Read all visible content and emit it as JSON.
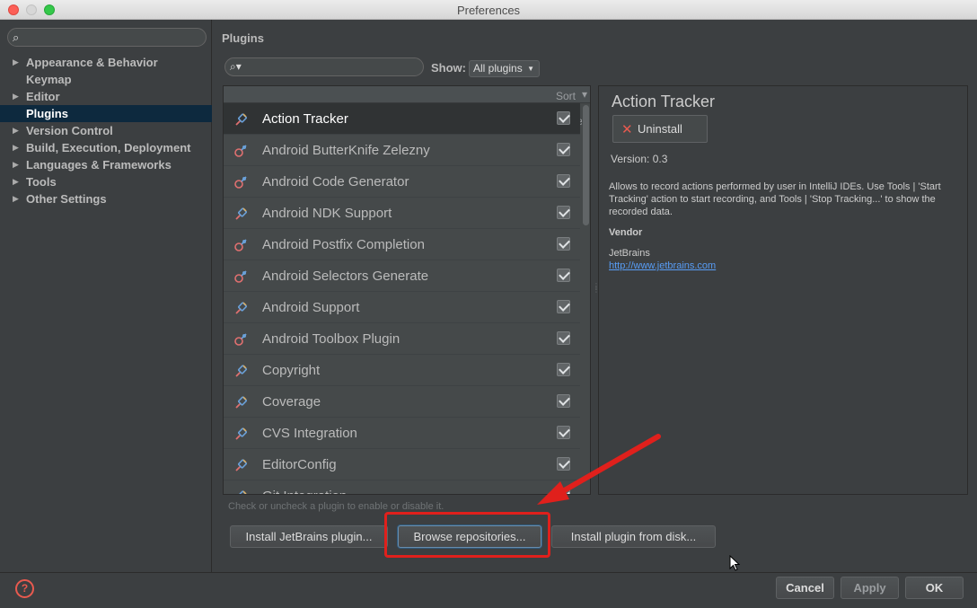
{
  "window": {
    "title": "Preferences"
  },
  "sidebar": {
    "items": [
      {
        "label": "Appearance & Behavior",
        "expandable": true
      },
      {
        "label": "Keymap",
        "expandable": false
      },
      {
        "label": "Editor",
        "expandable": true
      },
      {
        "label": "Plugins",
        "expandable": false,
        "selected": true
      },
      {
        "label": "Version Control",
        "expandable": true
      },
      {
        "label": "Build, Execution, Deployment",
        "expandable": true
      },
      {
        "label": "Languages & Frameworks",
        "expandable": true
      },
      {
        "label": "Tools",
        "expandable": true
      },
      {
        "label": "Other Settings",
        "expandable": true
      }
    ]
  },
  "plugins": {
    "title": "Plugins",
    "show_label": "Show:",
    "show_value": "All plugins",
    "sort_label": "Sort by: name",
    "list": [
      {
        "name": "Action Tracker",
        "checked": true,
        "selected": true
      },
      {
        "name": "Android ButterKnife Zelezny",
        "checked": true
      },
      {
        "name": "Android Code Generator",
        "checked": true
      },
      {
        "name": "Android NDK Support",
        "checked": true
      },
      {
        "name": "Android Postfix Completion",
        "checked": true
      },
      {
        "name": "Android Selectors Generate",
        "checked": true
      },
      {
        "name": "Android Support",
        "checked": true
      },
      {
        "name": "Android Toolbox Plugin",
        "checked": true
      },
      {
        "name": "Copyright",
        "checked": true
      },
      {
        "name": "Coverage",
        "checked": true
      },
      {
        "name": "CVS Integration",
        "checked": true
      },
      {
        "name": "EditorConfig",
        "checked": true
      },
      {
        "name": "Git Integration",
        "checked": true
      }
    ],
    "hint": "Check or uncheck a plugin to enable or disable it.",
    "buttons": {
      "install_jetbrains": "Install JetBrains plugin...",
      "browse": "Browse repositories...",
      "install_disk": "Install plugin from disk..."
    }
  },
  "details": {
    "title": "Action Tracker",
    "uninstall_label": "Uninstall",
    "version": "Version: 0.3",
    "description": "Allows to record actions performed by user in IntelliJ IDEs. Use Tools | 'Start Tracking' action to start recording, and Tools | 'Stop Tracking...' to show the recorded data.",
    "vendor_heading": "Vendor",
    "vendor_name": "JetBrains",
    "vendor_url": "http://www.jetbrains.com"
  },
  "footer": {
    "cancel": "Cancel",
    "apply": "Apply",
    "ok": "OK",
    "help_glyph": "?"
  },
  "colors": {
    "accent_annotation": "#e0201c",
    "selection": "#0d293e",
    "link": "#589df6"
  }
}
